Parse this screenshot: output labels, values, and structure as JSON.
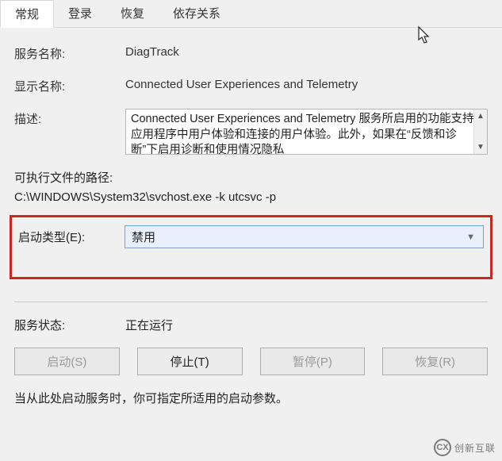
{
  "tabs": {
    "general": "常规",
    "logon": "登录",
    "recovery": "恢复",
    "dependencies": "依存关系"
  },
  "fields": {
    "service_name_label": "服务名称:",
    "service_name_value": "DiagTrack",
    "display_name_label": "显示名称:",
    "display_name_value": "Connected User Experiences and Telemetry",
    "description_label": "描述:",
    "description_value": "Connected User Experiences and Telemetry 服务所启用的功能支持应用程序中用户体验和连接的用户体验。此外，如果在“反馈和诊断”下启用诊断和使用情况隐私",
    "exe_path_label": "可执行文件的路径:",
    "exe_path_value": "C:\\WINDOWS\\System32\\svchost.exe -k utcsvc -p",
    "startup_type_label": "启动类型(E):",
    "startup_type_value": "禁用"
  },
  "status": {
    "label": "服务状态:",
    "value": "正在运行"
  },
  "buttons": {
    "start": "启动(S)",
    "stop": "停止(T)",
    "pause": "暂停(P)",
    "resume": "恢复(R)"
  },
  "hint": "当从此处启动服务时，你可指定所适用的启动参数。",
  "logo": "创新互联"
}
